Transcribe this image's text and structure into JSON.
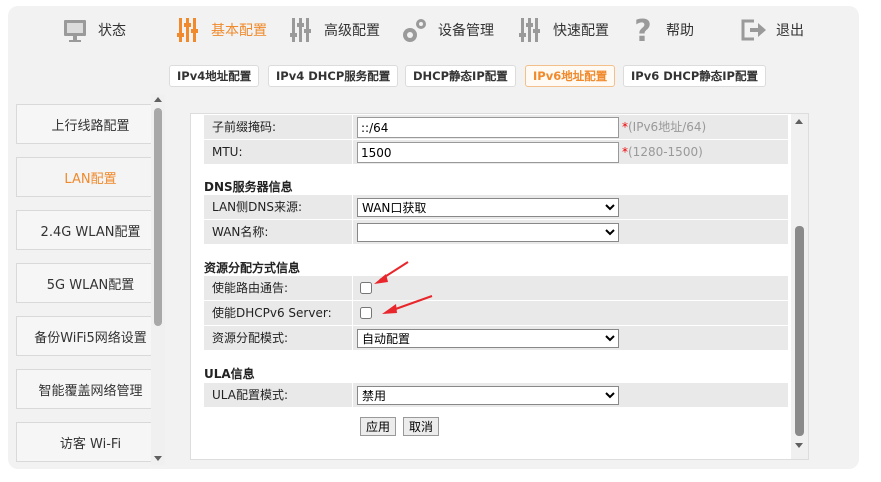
{
  "nav": [
    {
      "label": "状态",
      "icon": "monitor-icon",
      "active": false
    },
    {
      "label": "基本配置",
      "icon": "sliders-icon",
      "active": true
    },
    {
      "label": "高级配置",
      "icon": "sliders-icon",
      "active": false
    },
    {
      "label": "设备管理",
      "icon": "gears-icon",
      "active": false
    },
    {
      "label": "快速配置",
      "icon": "sliders-icon",
      "active": false
    },
    {
      "label": "帮助",
      "icon": "question-icon",
      "active": false
    },
    {
      "label": "退出",
      "icon": "exit-icon",
      "active": false
    }
  ],
  "subtabs": [
    {
      "label": "IPv4地址配置"
    },
    {
      "label": "IPv4 DHCP服务配置"
    },
    {
      "label": "DHCP静态IP配置"
    },
    {
      "label": "IPv6地址配置",
      "active": true
    },
    {
      "label": "IPv6 DHCP静态IP配置"
    }
  ],
  "sidebar": [
    {
      "label": "上行线路配置"
    },
    {
      "label": "LAN配置",
      "active": true
    },
    {
      "label": "2.4G WLAN配置"
    },
    {
      "label": "5G WLAN配置"
    },
    {
      "label": "备份WiFi5网络设置"
    },
    {
      "label": "智能覆盖网络管理"
    },
    {
      "label": "访客 Wi-Fi"
    }
  ],
  "form": {
    "prefix_mask": {
      "label": "子前缀掩码:",
      "value": "::/64",
      "hint_star": "*",
      "hint": "(IPv6地址/64)"
    },
    "mtu": {
      "label": "MTU:",
      "value": "1500",
      "hint_star": "*",
      "hint": "(1280-1500)"
    },
    "dns_section": "DNS服务器信息",
    "lan_dns_source": {
      "label": "LAN侧DNS来源:",
      "value": "WAN口获取"
    },
    "wan_name": {
      "label": "WAN名称:",
      "value": ""
    },
    "alloc_section": "资源分配方式信息",
    "enable_ra": {
      "label": "使能路由通告:",
      "checked": false
    },
    "enable_dhcpv6": {
      "label": "使能DHCPv6 Server:",
      "checked": false
    },
    "alloc_mode": {
      "label": "资源分配模式:",
      "value": "自动配置"
    },
    "ula_section": "ULA信息",
    "ula_mode": {
      "label": "ULA配置模式:",
      "value": "禁用"
    },
    "apply": "应用",
    "cancel": "取消"
  },
  "colors": {
    "accent": "#f08a2c",
    "annotation": "#e8262b"
  }
}
